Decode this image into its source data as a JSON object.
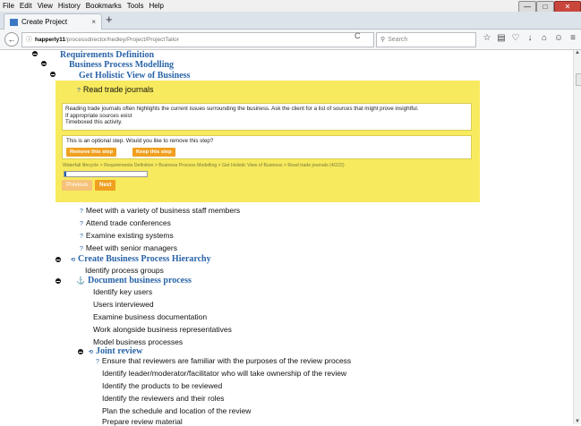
{
  "menubar": [
    "File",
    "Edit",
    "View",
    "History",
    "Bookmarks",
    "Tools",
    "Help"
  ],
  "window_controls": {
    "min": "—",
    "max": "□",
    "close": "✕"
  },
  "tab": {
    "title": "Create Project",
    "close": "×",
    "new": "+"
  },
  "url": {
    "host": "happerly11",
    "path": "/processdirector/hedley/Project/ProjectTailor",
    "info": "ⓘ"
  },
  "search": {
    "placeholder": "Search"
  },
  "tree": [
    {
      "text": "Requirements Definition",
      "kind": "h1"
    },
    {
      "text": "Business Process Modelling",
      "kind": "h1"
    },
    {
      "text": "Get Holistic View of Business",
      "kind": "h1"
    }
  ],
  "panel": {
    "title": "Read trade journals",
    "description": "Reading trade journals often highlights the current issues surrounding the business. Ask the client for a list of sources that might prove insightful.\nIf appropriate sources exist\nTimeboxed this activity.",
    "optional_text": "This is an optional step. Would you like to remove this step?",
    "remove_label": "Remove this step",
    "keep_label": "Keep this step",
    "breadcrumb": "Waterfall lifecycle > Requirements Definition > Business Process Modelling > Get Holistic View of Business > Read trade journals (4/222)",
    "progress_fraction": 0.018,
    "prev_label": "Previous",
    "next_label": "Next"
  },
  "steps_after": [
    "Meet with a variety of business staff members",
    "Attend trade conferences",
    "Examine existing systems",
    "Meet with senior managers"
  ],
  "hierarchy": {
    "title": "Create Business Process Hierarchy",
    "child": "Identify process groups",
    "document": "Document business process",
    "doc_items": [
      "Identify key users",
      "Users interviewed",
      "Examine business documentation",
      "Work alongside business representatives",
      "Model business processes"
    ],
    "joint": "Joint review",
    "joint_items": [
      "Ensure that reviewers are familiar with the purposes of the review process",
      "Identify leader/moderator/facilitator who will take ownership of the review",
      "Identify the products to be reviewed",
      "Identify the reviewers and their roles",
      "Plan the schedule and location of the review",
      "Prepare review material"
    ]
  },
  "icons": {
    "question": "?",
    "anchor": "⚓",
    "sync": "⟲",
    "back": "←",
    "reload": "C"
  },
  "colors": {
    "heading": "#2a64a8",
    "panel": "#f7ea5e",
    "button": "#f0a020",
    "progress": "#1e5fb0"
  }
}
